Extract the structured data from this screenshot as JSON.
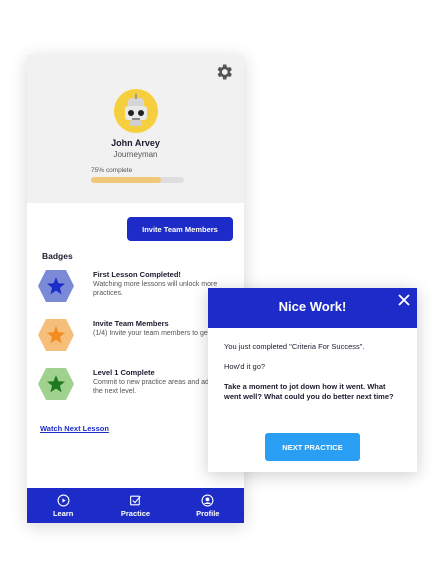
{
  "profile": {
    "name": "John Arvey",
    "rank": "Journeyman",
    "progress_text": "75% complete",
    "progress": 0.75
  },
  "actions": {
    "invite_label": "Invite Team Members"
  },
  "badges": {
    "title": "Badges",
    "items": [
      {
        "title": "First Lesson Completed!",
        "description": "Watching more lessons will unlock more practices.",
        "hex_color": "#7b8ad6",
        "star_color": "#1d2cc8",
        "icon": "star-icon"
      },
      {
        "title": "Invite Team Members",
        "description": "(1/4) Invite your team members to get feedback.",
        "hex_color": "#f5be7a",
        "star_color": "#f28c1e",
        "icon": "star-icon"
      },
      {
        "title": "Level 1 Complete",
        "description": "Commit to new practice areas and advance to the next level.",
        "hex_color": "#9fd18f",
        "star_color": "#1f7a1f",
        "icon": "star-icon"
      }
    ]
  },
  "watch_next_label": "Watch Next Lesson",
  "nav": {
    "items": [
      {
        "label": "Learn",
        "icon": "play-circle-icon"
      },
      {
        "label": "Practice",
        "icon": "checkbox-icon"
      },
      {
        "label": "Profile",
        "icon": "user-circle-icon"
      }
    ]
  },
  "modal": {
    "title": "Nice Work!",
    "line1": "You just completed \"Criteria For Success\".",
    "line2": "How'd it go?",
    "line3": "Take a moment to jot down how it went. What went well? What could you do better next time?",
    "button_label": "NEXT PRACTICE"
  },
  "colors": {
    "primary": "#1d2cc8",
    "button_blue": "#2a9ef2",
    "progress": "#f0c87a"
  }
}
